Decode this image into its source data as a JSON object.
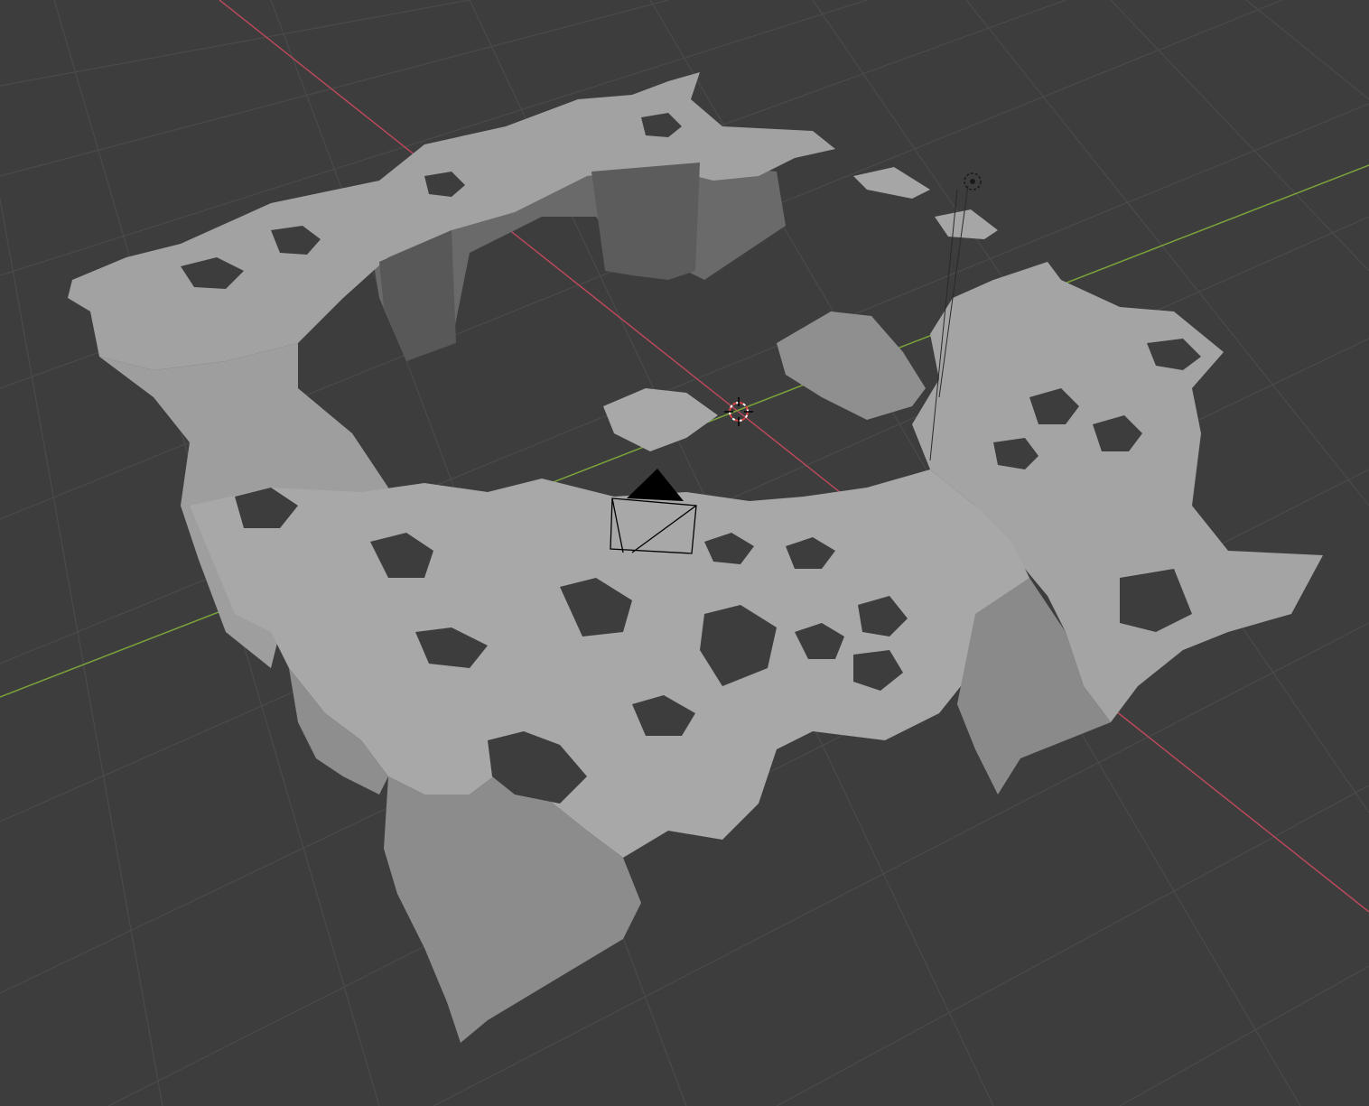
{
  "app": {
    "name": "3D viewport",
    "view": "perspective"
  },
  "colors": {
    "background": "#3d3d3d",
    "grid_line": "#4a4a4a",
    "x_axis": "#b9485a",
    "y_axis": "#7ba33a",
    "mesh_light": "#a8a8a8",
    "mesh_mid": "#8e8e8e",
    "mesh_dark": "#5a5a5a",
    "hole": "#3d3d3d",
    "camera": "#000000",
    "cursor_red": "#e04040",
    "cursor_white": "#ffffff"
  },
  "objects": [
    {
      "name": "scan-mesh",
      "type": "mesh"
    },
    {
      "name": "camera",
      "type": "camera"
    },
    {
      "name": "light",
      "type": "light"
    },
    {
      "name": "3d-cursor",
      "type": "cursor"
    }
  ]
}
